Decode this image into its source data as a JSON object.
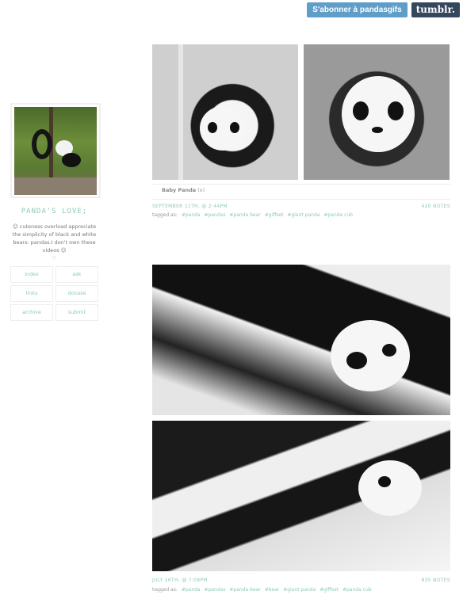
{
  "topbar": {
    "follow_label": "S'abonner à pandasgifs",
    "tumblr_label": "tumblr."
  },
  "sidebar": {
    "title": "PANDA'S LOVE;",
    "description": "☺ cuteness overload appreciate the simplicity of black and white bears: pandas.I don't own these videos ☺",
    "heart": "♡",
    "nav": [
      {
        "label": "index"
      },
      {
        "label": "ask"
      },
      {
        "label": "links"
      },
      {
        "label": "donate"
      },
      {
        "label": "archive"
      },
      {
        "label": "submit"
      }
    ]
  },
  "posts": [
    {
      "caption_title": "Baby Panda",
      "caption_link": "(x)",
      "date": "SEPTEMBER 11TH, @ 2:44PM",
      "notes": "420 NOTES",
      "tags_prefix": "tagged as:",
      "tags": [
        "#panda",
        "#pandas",
        "#panda bear",
        "#giffset",
        "#giant panda",
        "#panda cub"
      ]
    },
    {
      "date": "JULY 16TH, @ 7:08PM",
      "notes": "835 NOTES",
      "tags_prefix": "tagged as:",
      "tags": [
        "#panda",
        "#pandas",
        "#panda bear",
        "#bear",
        "#giant panda",
        "#giffset",
        "#panda cub"
      ]
    }
  ],
  "colors": {
    "accent": "#8ccbb4",
    "follow_button": "#5e9ec9",
    "tumblr_button": "#36465d"
  }
}
